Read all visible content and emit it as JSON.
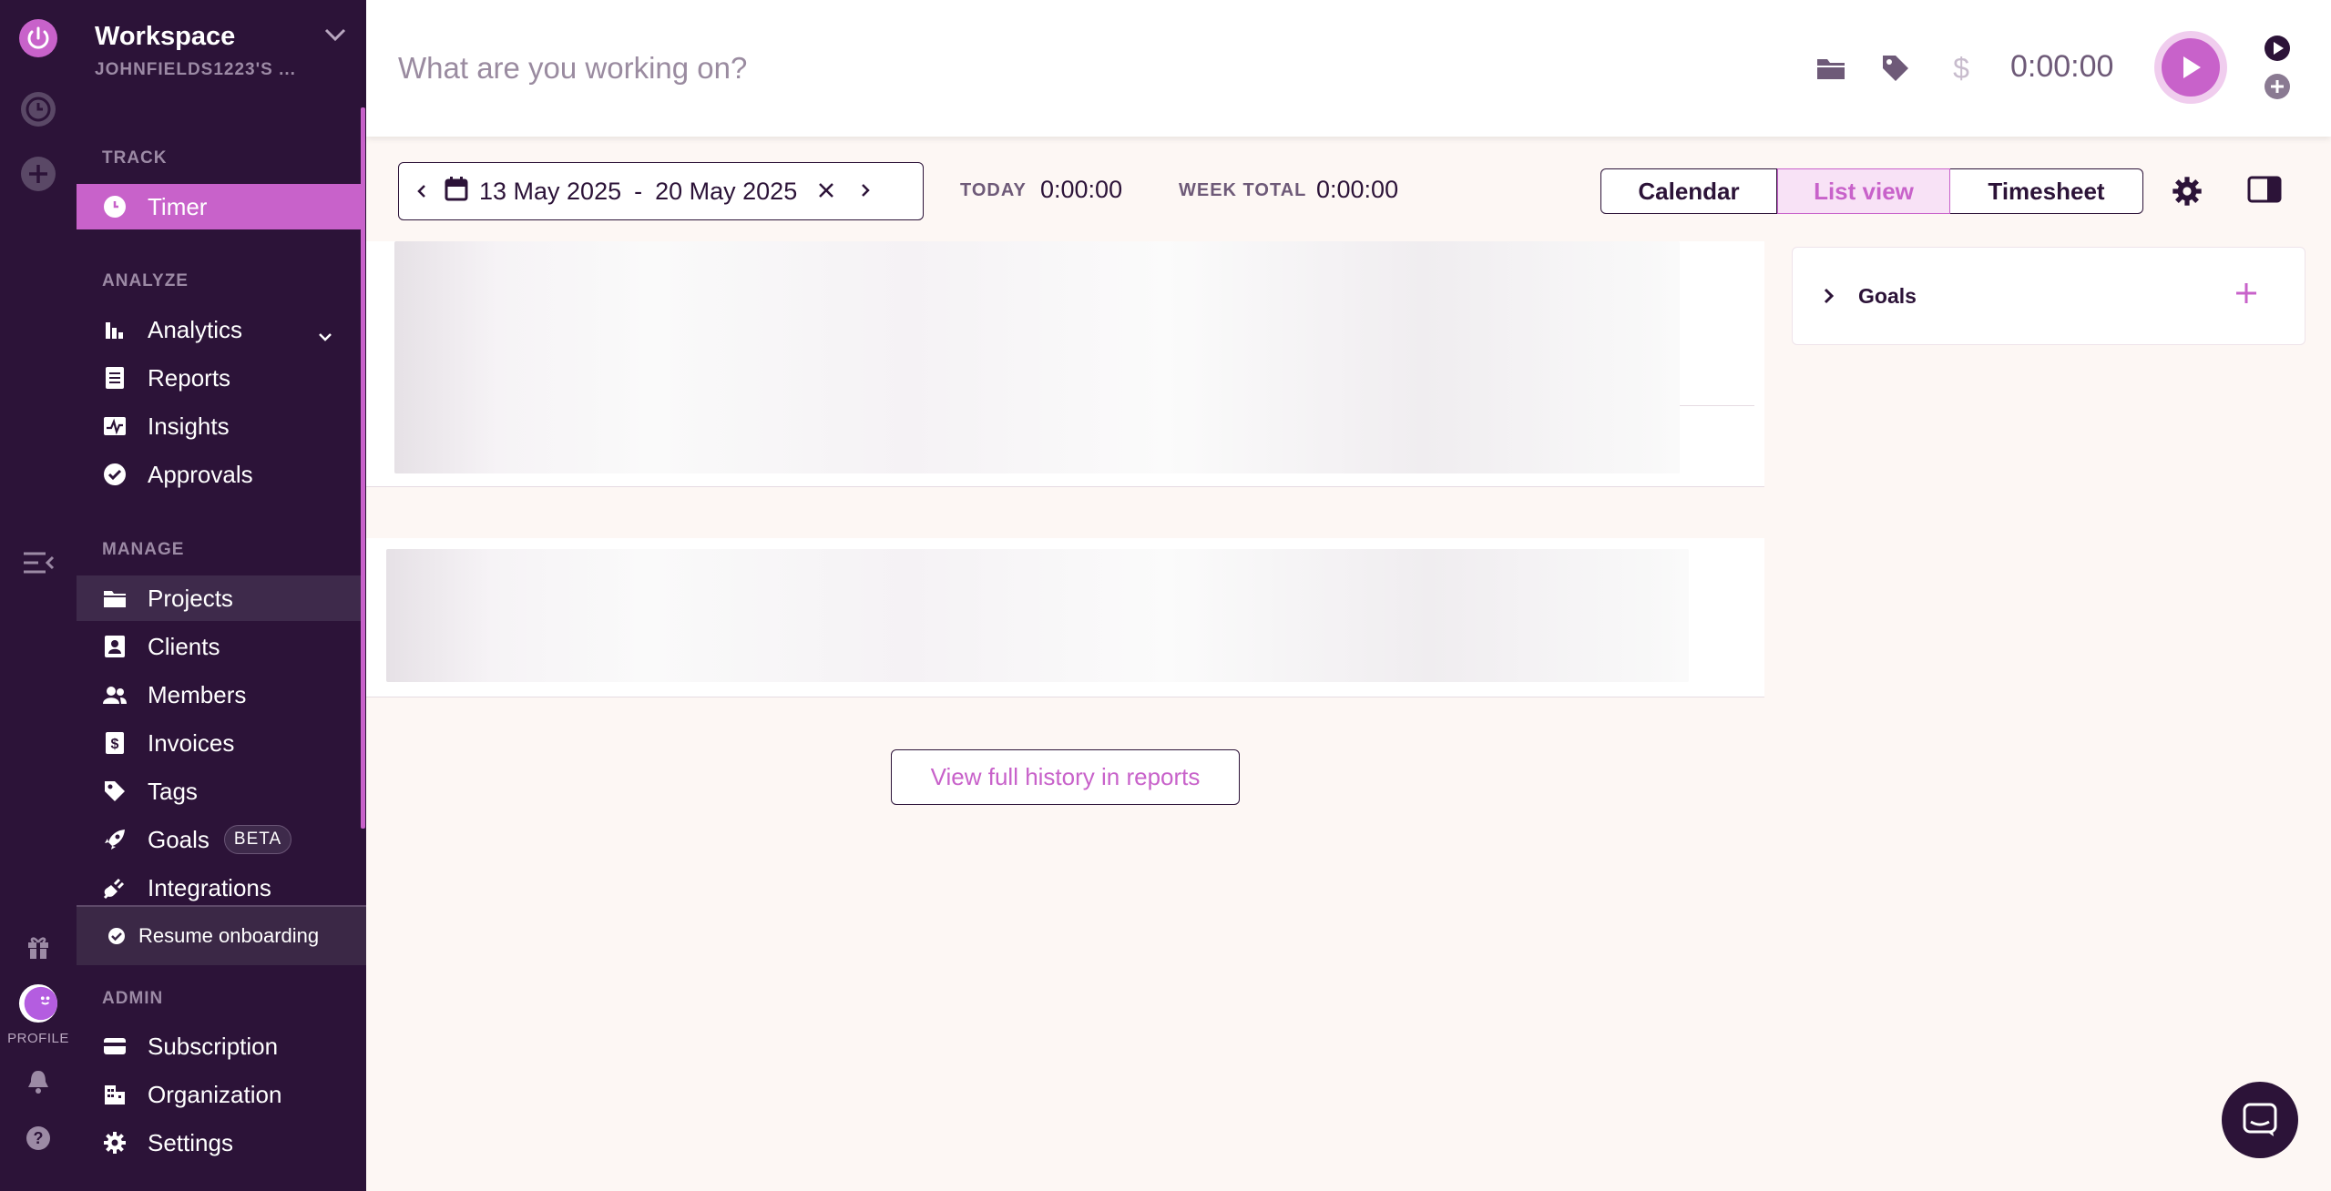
{
  "workspace": {
    "name": "Workspace",
    "sub": "JOHNFIELDS1223'S ..."
  },
  "rail": {
    "profile_label": "PROFILE"
  },
  "sidebar": {
    "sections": {
      "track": "TRACK",
      "analyze": "ANALYZE",
      "manage": "MANAGE",
      "admin": "ADMIN"
    },
    "items": {
      "timer": "Timer",
      "analytics": "Analytics",
      "reports": "Reports",
      "insights": "Insights",
      "approvals": "Approvals",
      "projects": "Projects",
      "clients": "Clients",
      "members": "Members",
      "invoices": "Invoices",
      "tags": "Tags",
      "goals": "Goals",
      "integrations": "Integrations",
      "subscription": "Subscription",
      "organization": "Organization",
      "settings": "Settings"
    },
    "goals_badge": "BETA",
    "onboarding": "Resume onboarding"
  },
  "timer": {
    "placeholder": "What are you working on?",
    "time": "0:00:00",
    "billable_symbol": "$"
  },
  "toolbar": {
    "date_start": "13 May 2025",
    "date_sep": "-",
    "date_end": "20 May 2025",
    "today_label": "TODAY",
    "today_value": "0:00:00",
    "week_label": "WEEK TOTAL",
    "week_value": "0:00:00",
    "views": {
      "calendar": "Calendar",
      "list": "List view",
      "timesheet": "Timesheet"
    },
    "active_view": "List view"
  },
  "history_button": "View full history in reports",
  "goals_panel": {
    "title": "Goals"
  },
  "colors": {
    "brand": "#c862ca",
    "dark": "#2c1338",
    "background": "#fdf7f4"
  },
  "icons": [
    "power-icon",
    "clock-icon",
    "plus-circle-icon",
    "collapse-icon",
    "gift-icon",
    "bell-icon",
    "help-icon",
    "folder-icon",
    "tag-icon",
    "dollar-icon",
    "play-icon",
    "gear-icon",
    "panel-icon",
    "chat-icon"
  ]
}
